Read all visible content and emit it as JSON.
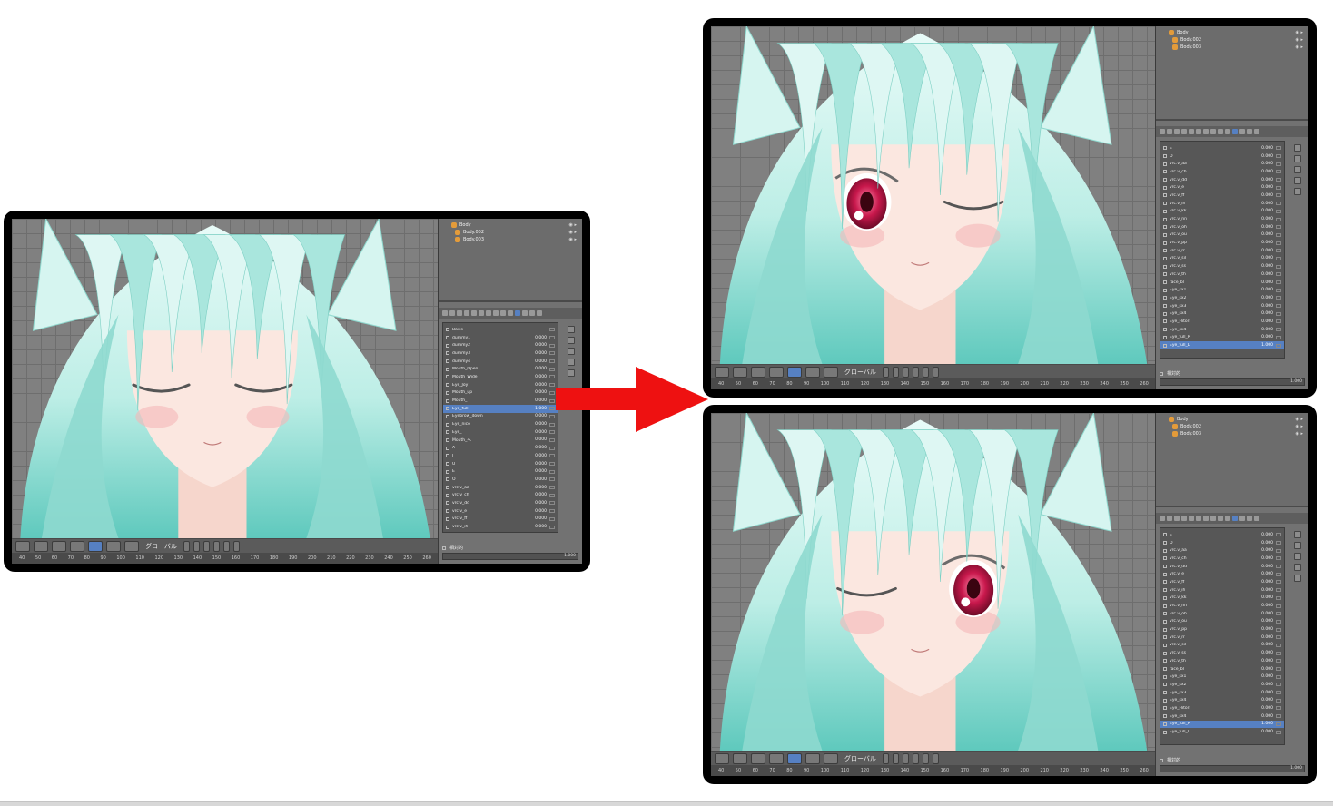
{
  "orientation_label": "グローバル",
  "relative_label": "相対的",
  "ruler_ticks": [
    "40",
    "50",
    "60",
    "70",
    "80",
    "90",
    "100",
    "110",
    "120",
    "130",
    "140",
    "150",
    "160",
    "170",
    "180",
    "190",
    "200",
    "210",
    "220",
    "230",
    "240",
    "250",
    "260"
  ],
  "outliner": [
    "Body",
    "Body.002",
    "Body.003"
  ],
  "value_default": "1.000",
  "arrow_color": "#ee1111",
  "panels": {
    "left": {
      "eye_state": "both closed",
      "shape_keys": [
        {
          "name": "Basis",
          "value": ""
        },
        {
          "name": "dummy1",
          "value": "0.000"
        },
        {
          "name": "dummy2",
          "value": "0.000"
        },
        {
          "name": "dummy3",
          "value": "0.000"
        },
        {
          "name": "dummy4",
          "value": "0.000"
        },
        {
          "name": "Mouth_Open",
          "value": "0.000"
        },
        {
          "name": "Mouth_Wide",
          "value": "0.000"
        },
        {
          "name": "Eye_Joy",
          "value": "0.000"
        },
        {
          "name": "Mouth_up",
          "value": "0.000"
        },
        {
          "name": "Mouth_",
          "value": "0.000"
        },
        {
          "name": "Eye_full",
          "value": "1.000",
          "active": true
        },
        {
          "name": "Eyebrow_down",
          "value": "0.000"
        },
        {
          "name": "Eye_nico",
          "value": "0.000"
        },
        {
          "name": "Eye_",
          "value": "0.000"
        },
        {
          "name": "Mouth_ヘ",
          "value": "0.000"
        },
        {
          "name": "A",
          "value": "0.000"
        },
        {
          "name": "I",
          "value": "0.000"
        },
        {
          "name": "U",
          "value": "0.000"
        },
        {
          "name": "E",
          "value": "0.000"
        },
        {
          "name": "O",
          "value": "0.000"
        },
        {
          "name": "vrc.v_aa",
          "value": "0.000"
        },
        {
          "name": "vrc.v_ch",
          "value": "0.000"
        },
        {
          "name": "vrc.v_dd",
          "value": "0.000"
        },
        {
          "name": "vrc.v_e",
          "value": "0.000"
        },
        {
          "name": "vrc.v_ff",
          "value": "0.000"
        },
        {
          "name": "vrc.v_ih",
          "value": "0.000"
        }
      ]
    },
    "top_right": {
      "eye_state": "left wink",
      "shape_keys": [
        {
          "name": "E",
          "value": "0.000"
        },
        {
          "name": "O",
          "value": "0.000"
        },
        {
          "name": "vrc.v_aa",
          "value": "0.000"
        },
        {
          "name": "vrc.v_ch",
          "value": "0.000"
        },
        {
          "name": "vrc.v_dd",
          "value": "0.000"
        },
        {
          "name": "vrc.v_e",
          "value": "0.000"
        },
        {
          "name": "vrc.v_ff",
          "value": "0.000"
        },
        {
          "name": "vrc.v_ih",
          "value": "0.000"
        },
        {
          "name": "vrc.v_kk",
          "value": "0.000"
        },
        {
          "name": "vrc.v_nn",
          "value": "0.000"
        },
        {
          "name": "vrc.v_oh",
          "value": "0.000"
        },
        {
          "name": "vrc.v_ou",
          "value": "0.000"
        },
        {
          "name": "vrc.v_pp",
          "value": "0.000"
        },
        {
          "name": "vrc.v_rr",
          "value": "0.000"
        },
        {
          "name": "vrc.v_sil",
          "value": "0.000"
        },
        {
          "name": "vrc.v_ss",
          "value": "0.000"
        },
        {
          "name": "vrc.v_th",
          "value": "0.000"
        },
        {
          "name": "face_bl",
          "value": "0.000"
        },
        {
          "name": "Eye_sx1",
          "value": "0.000"
        },
        {
          "name": "Eye_sx2",
          "value": "0.000"
        },
        {
          "name": "Eye_sx3",
          "value": "0.000"
        },
        {
          "name": "Eye_sx4",
          "value": "0.000"
        },
        {
          "name": "Eye_Hitori",
          "value": "0.000"
        },
        {
          "name": "Eye_sx4",
          "value": "0.000"
        },
        {
          "name": "Eye_full_R",
          "value": "0.000"
        },
        {
          "name": "Eye_full_L",
          "value": "1.000",
          "active": true
        }
      ]
    },
    "bottom_right": {
      "eye_state": "right wink",
      "shape_keys": [
        {
          "name": "E",
          "value": "0.000"
        },
        {
          "name": "O",
          "value": "0.000"
        },
        {
          "name": "vrc.v_aa",
          "value": "0.000"
        },
        {
          "name": "vrc.v_ch",
          "value": "0.000"
        },
        {
          "name": "vrc.v_dd",
          "value": "0.000"
        },
        {
          "name": "vrc.v_e",
          "value": "0.000"
        },
        {
          "name": "vrc.v_ff",
          "value": "0.000"
        },
        {
          "name": "vrc.v_ih",
          "value": "0.000"
        },
        {
          "name": "vrc.v_kk",
          "value": "0.000"
        },
        {
          "name": "vrc.v_nn",
          "value": "0.000"
        },
        {
          "name": "vrc.v_oh",
          "value": "0.000"
        },
        {
          "name": "vrc.v_ou",
          "value": "0.000"
        },
        {
          "name": "vrc.v_pp",
          "value": "0.000"
        },
        {
          "name": "vrc.v_rr",
          "value": "0.000"
        },
        {
          "name": "vrc.v_sil",
          "value": "0.000"
        },
        {
          "name": "vrc.v_ss",
          "value": "0.000"
        },
        {
          "name": "vrc.v_th",
          "value": "0.000"
        },
        {
          "name": "face_bl",
          "value": "0.000"
        },
        {
          "name": "Eye_sx1",
          "value": "0.000"
        },
        {
          "name": "Eye_sx2",
          "value": "0.000"
        },
        {
          "name": "Eye_sx3",
          "value": "0.000"
        },
        {
          "name": "Eye_sx4",
          "value": "0.000"
        },
        {
          "name": "Eye_Hitori",
          "value": "0.000"
        },
        {
          "name": "Eye_sx4",
          "value": "0.000"
        },
        {
          "name": "Eye_full_R",
          "value": "1.000",
          "active": true
        },
        {
          "name": "Eye_full_L",
          "value": "0.000"
        }
      ]
    }
  }
}
